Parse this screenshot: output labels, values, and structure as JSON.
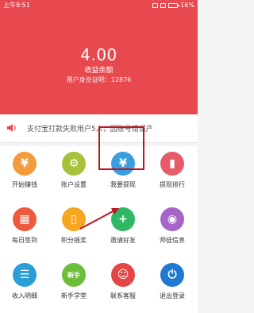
{
  "status_bar": {
    "time": "上午9:51",
    "battery": "16%"
  },
  "header": {
    "amount": "4.00",
    "amount_label": "收益余额",
    "user_id_label": "用户身份证明：",
    "user_id": "12876"
  },
  "notice": {
    "text": "支付宝打款失败用户5人，因账号错误产"
  },
  "grid": {
    "items": [
      {
        "label": "开始赚钱",
        "icon": "yuan-coin-icon",
        "color": "#f39c3d",
        "glyph": "¥"
      },
      {
        "label": "账户设置",
        "icon": "gear-icon",
        "color": "#a7c23a",
        "glyph": "⚙"
      },
      {
        "label": "我要提现",
        "icon": "yuan-withdraw-icon",
        "color": "#3a9fe0",
        "glyph": "¥"
      },
      {
        "label": "提现排行",
        "icon": "bar-chart-icon",
        "color": "#e65c6a",
        "glyph": "▮"
      },
      {
        "label": "每日签到",
        "icon": "calendar-icon",
        "color": "#ef5a3c",
        "glyph": "▦"
      },
      {
        "label": "积分摇奖",
        "icon": "phone-icon",
        "color": "#f5a623",
        "glyph": "▯"
      },
      {
        "label": "邀请好友",
        "icon": "add-user-icon",
        "color": "#2fb765",
        "glyph": "+"
      },
      {
        "label": "师徒信息",
        "icon": "users-icon",
        "color": "#a565c9",
        "glyph": "◉"
      },
      {
        "label": "收入明细",
        "icon": "receipt-icon",
        "color": "#2a9fd6",
        "glyph": "☰"
      },
      {
        "label": "新手学堂",
        "icon": "newbie-icon",
        "color": "#6dbf3a",
        "glyph": "新手"
      },
      {
        "label": "联系客服",
        "icon": "headset-icon",
        "color": "#e64545",
        "glyph": "☺"
      },
      {
        "label": "退出登录",
        "icon": "power-icon",
        "color": "#1f78d1",
        "glyph": "⏻"
      }
    ]
  }
}
